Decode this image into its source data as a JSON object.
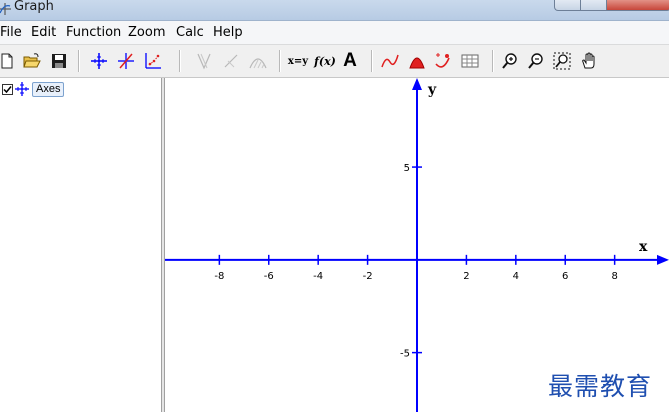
{
  "window": {
    "title": "Graph"
  },
  "menu": {
    "items": [
      "File",
      "Edit",
      "Function",
      "Zoom",
      "Calc",
      "Help"
    ]
  },
  "toolbar": {
    "xy_label": "x=y",
    "fx_label": "f(x)",
    "text_label": "A",
    "icons": [
      "new-file-icon",
      "open-folder-icon",
      "save-disk-icon",
      "axes-icon",
      "insert-function-icon",
      "point-series-icon",
      "tangent-icon",
      "shading-icon",
      "relation-icon",
      "xy-evaluate-icon",
      "fx-icon",
      "insert-text-icon",
      "curve-icon",
      "area-icon",
      "trendline-icon",
      "table-icon",
      "zoom-in-icon",
      "zoom-out-icon",
      "zoom-window-icon",
      "hand-pan-icon"
    ]
  },
  "tree": {
    "items": [
      {
        "label": "Axes",
        "checked": true
      }
    ]
  },
  "graph": {
    "x_axis_label": "x",
    "y_axis_label": "y",
    "x_range": [
      -10.2,
      10.2
    ],
    "y_range": [
      -8.2,
      9.8
    ],
    "x_ticks": [
      -8,
      -6,
      -4,
      -2,
      2,
      4,
      6,
      8
    ],
    "y_ticks": [
      5,
      -5
    ],
    "axis_color": "#0000ff"
  },
  "watermark": {
    "text": "最需教育"
  }
}
